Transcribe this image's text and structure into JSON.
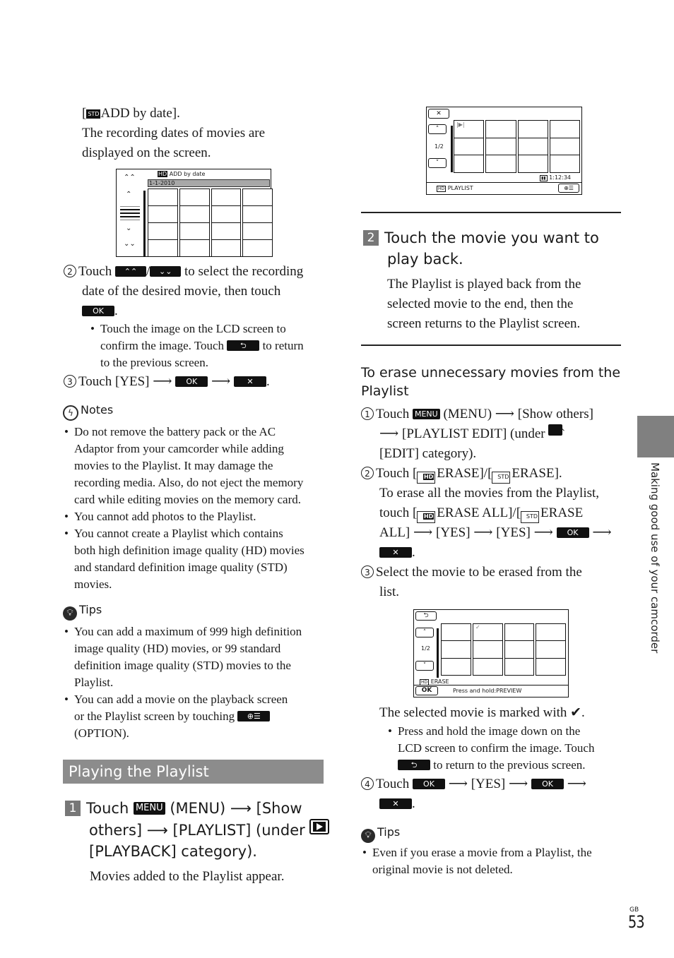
{
  "left_column": {
    "intro": {
      "add_by_date_open": "[",
      "add_by_date_icon": "STD",
      "add_by_date_label": "ADD by date].",
      "line2": "The recording dates of movies are",
      "line3": "displayed on the screen."
    },
    "screen_add_by_date": {
      "title_icon": "HD",
      "title": "ADD by date",
      "date": "1-1-2010",
      "rows": 4,
      "cols": 4
    },
    "step2": {
      "num": "2",
      "touch": "Touch",
      "slash": "/",
      "text1": "to select the recording",
      "text2": "date of the desired movie, then touch",
      "ok": "OK",
      "period": ".",
      "sub_bullet_1": "Touch the image on the LCD screen to",
      "sub_bullet_2a": "confirm the image. Touch",
      "sub_bullet_2b": "to return",
      "sub_bullet_3": "to the previous screen."
    },
    "step3": {
      "num": "3",
      "text": "Touch [YES]",
      "arrow": "⟶",
      "ok": "OK",
      "close": "✕",
      "period": "."
    },
    "notes": {
      "heading": "Notes",
      "items": [
        [
          "Do not remove the battery pack or the AC",
          "Adaptor from your camcorder while adding",
          "movies to the Playlist. It may damage the",
          "recording media. Also, do not eject the memory",
          "card while editing movies on the memory card."
        ],
        [
          "You cannot add photos to the Playlist."
        ],
        [
          "You cannot create a Playlist which contains",
          "both high definition image quality (HD) movies",
          "and standard definition image quality (STD)",
          "movies."
        ]
      ]
    },
    "tips": {
      "heading": "Tips",
      "item1": [
        "You can add a maximum of 999 high definition",
        "image quality (HD) movies, or 99 standard",
        "definition image quality (STD) movies to the",
        "Playlist."
      ],
      "item2_line1": "You can add a movie on the playback screen",
      "item2_line2": "or the Playlist screen by touching",
      "item2_line3": "(OPTION)."
    },
    "section_title": "Playing the Playlist",
    "step1": {
      "num": "1",
      "touch": "Touch",
      "menu": "MENU",
      "line1_rest": "(MENU) ⟶ [Show",
      "line2": "others] ⟶ [PLAYLIST] (under",
      "line3": "[PLAYBACK] category).",
      "body": "Movies added to the Playlist appear."
    }
  },
  "right_column": {
    "screen_playlist": {
      "close": "✕",
      "up": "˄",
      "page": "1/2",
      "down": "˅",
      "play_mark": "|▶|",
      "duration": "1:12:34",
      "footer_icon": "HD",
      "footer_label": "PLAYLIST"
    },
    "step2": {
      "num": "2",
      "heading_line1": "Touch the movie you want to",
      "heading_line2": "play back.",
      "body": [
        "The Playlist is played back from the",
        "selected movie to the end, then the",
        "screen returns to the Playlist screen."
      ]
    },
    "erase": {
      "heading_line1": "To erase unnecessary movies from the",
      "heading_line2": "Playlist",
      "s1_num": "1",
      "s1_touch": "Touch",
      "s1_menu": "MENU",
      "s1_rest": "(MENU) ⟶ [Show others]",
      "s1_line2": "⟶ [PLAYLIST EDIT] (under",
      "s1_line3": "[EDIT] category).",
      "s2_num": "2",
      "s2_line1a": "Touch [",
      "s2_hd": "HD",
      "s2_line1b": "ERASE]/[",
      "s2_std": "STD",
      "s2_line1c": "ERASE].",
      "s2_line2": "To erase all the movies from the Playlist,",
      "s2_line3a": "touch [",
      "s2_line3b": "ERASE ALL]/[",
      "s2_line3c": "ERASE",
      "s2_line4": "ALL] ⟶ [YES] ⟶ [YES] ⟶",
      "ok": "OK",
      "arrow": "⟶",
      "close": "✕",
      "period": ".",
      "s3_num": "3",
      "s3_line1": "Select the movie to be erased from the",
      "s3_line2": "list."
    },
    "screen_erase": {
      "back": "⮌",
      "up": "˄",
      "page": "1/2",
      "down": "˅",
      "check": "✓",
      "footer_icon": "HD",
      "footer_label": "ERASE",
      "ok": "OK",
      "hint": "Press and hold:PREVIEW"
    },
    "after_screen": {
      "marked": "The selected movie is marked with ✔.",
      "bullet_1": "Press and hold the image down on the",
      "bullet_2": "LCD screen to confirm the image. Touch",
      "bullet_3": "to return to the previous screen.",
      "s4_num": "4",
      "s4_touch": "Touch",
      "s4_mid": "⟶ [YES] ⟶",
      "s4_arrow": "⟶",
      "ok": "OK",
      "close": "✕",
      "period": "."
    },
    "tips": {
      "heading": "Tips",
      "line1": "Even if you erase a movie from a Playlist, the",
      "line2": "original movie is not deleted."
    }
  },
  "side_tab": {
    "label": "Making good use of your camcorder",
    "color": "#808080"
  },
  "footer": {
    "region": "GB",
    "page_number": "53"
  },
  "colors": {
    "section_bar": "#8c8c8c",
    "step_badge": "#777777"
  }
}
